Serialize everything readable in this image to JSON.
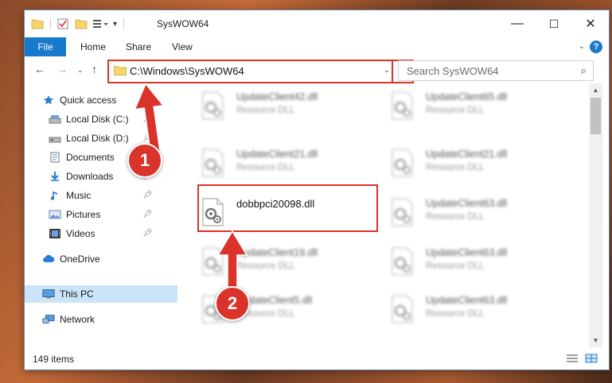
{
  "window": {
    "title": "SysWOW64",
    "controls": {
      "minimize": "—",
      "maximize": "☐",
      "close": "✕"
    }
  },
  "ribbon": {
    "tabs": [
      {
        "label": "File"
      },
      {
        "label": "Home"
      },
      {
        "label": "Share"
      },
      {
        "label": "View"
      }
    ],
    "help": "?"
  },
  "nav": {
    "address": "C:\\Windows\\SysWOW64",
    "search_placeholder": "Search SysWOW64"
  },
  "sidebar": {
    "items": [
      {
        "label": "Quick access",
        "icon": "star-icon"
      },
      {
        "label": "Local Disk (C:)",
        "icon": "drive-icon"
      },
      {
        "label": "Local Disk (D:)",
        "icon": "drive-icon"
      },
      {
        "label": "Documents",
        "icon": "documents-icon"
      },
      {
        "label": "Downloads",
        "icon": "download-icon"
      },
      {
        "label": "Music",
        "icon": "music-icon"
      },
      {
        "label": "Pictures",
        "icon": "pictures-icon"
      },
      {
        "label": "Videos",
        "icon": "videos-icon"
      },
      {
        "label": "OneDrive",
        "icon": "cloud-icon"
      },
      {
        "label": "This PC",
        "icon": "computer-icon"
      },
      {
        "label": "Network",
        "icon": "network-icon"
      }
    ]
  },
  "files": {
    "left": [
      {
        "name": "UpdateClient42.dll",
        "type": "Resource DLL"
      },
      {
        "name": "UpdateClient21.dll",
        "type": "Resource DLL"
      },
      {
        "name": "dobbpci20098.dll",
        "type": ""
      },
      {
        "name": "UpdateClient19.dll",
        "type": "Resource DLL"
      },
      {
        "name": "UpdateClient5.dll",
        "type": "Resource DLL"
      }
    ],
    "right": [
      {
        "name": "UpdateClient65.dll",
        "type": "Resource DLL"
      },
      {
        "name": "UpdateClient21.dll",
        "type": "Resource DLL"
      },
      {
        "name": "UpdateClient63.dll",
        "type": "Resource DLL"
      },
      {
        "name": "UpdateClient63.dll",
        "type": "Resource DLL"
      },
      {
        "name": "UpdateClient63.dll",
        "type": "Resource DLL"
      }
    ]
  },
  "status": {
    "count": "149 items"
  },
  "annotations": [
    {
      "number": "1"
    },
    {
      "number": "2"
    }
  ],
  "colors": {
    "accent": "#1979ca",
    "highlight": "#d9332a",
    "selected": "#cce4f7"
  }
}
